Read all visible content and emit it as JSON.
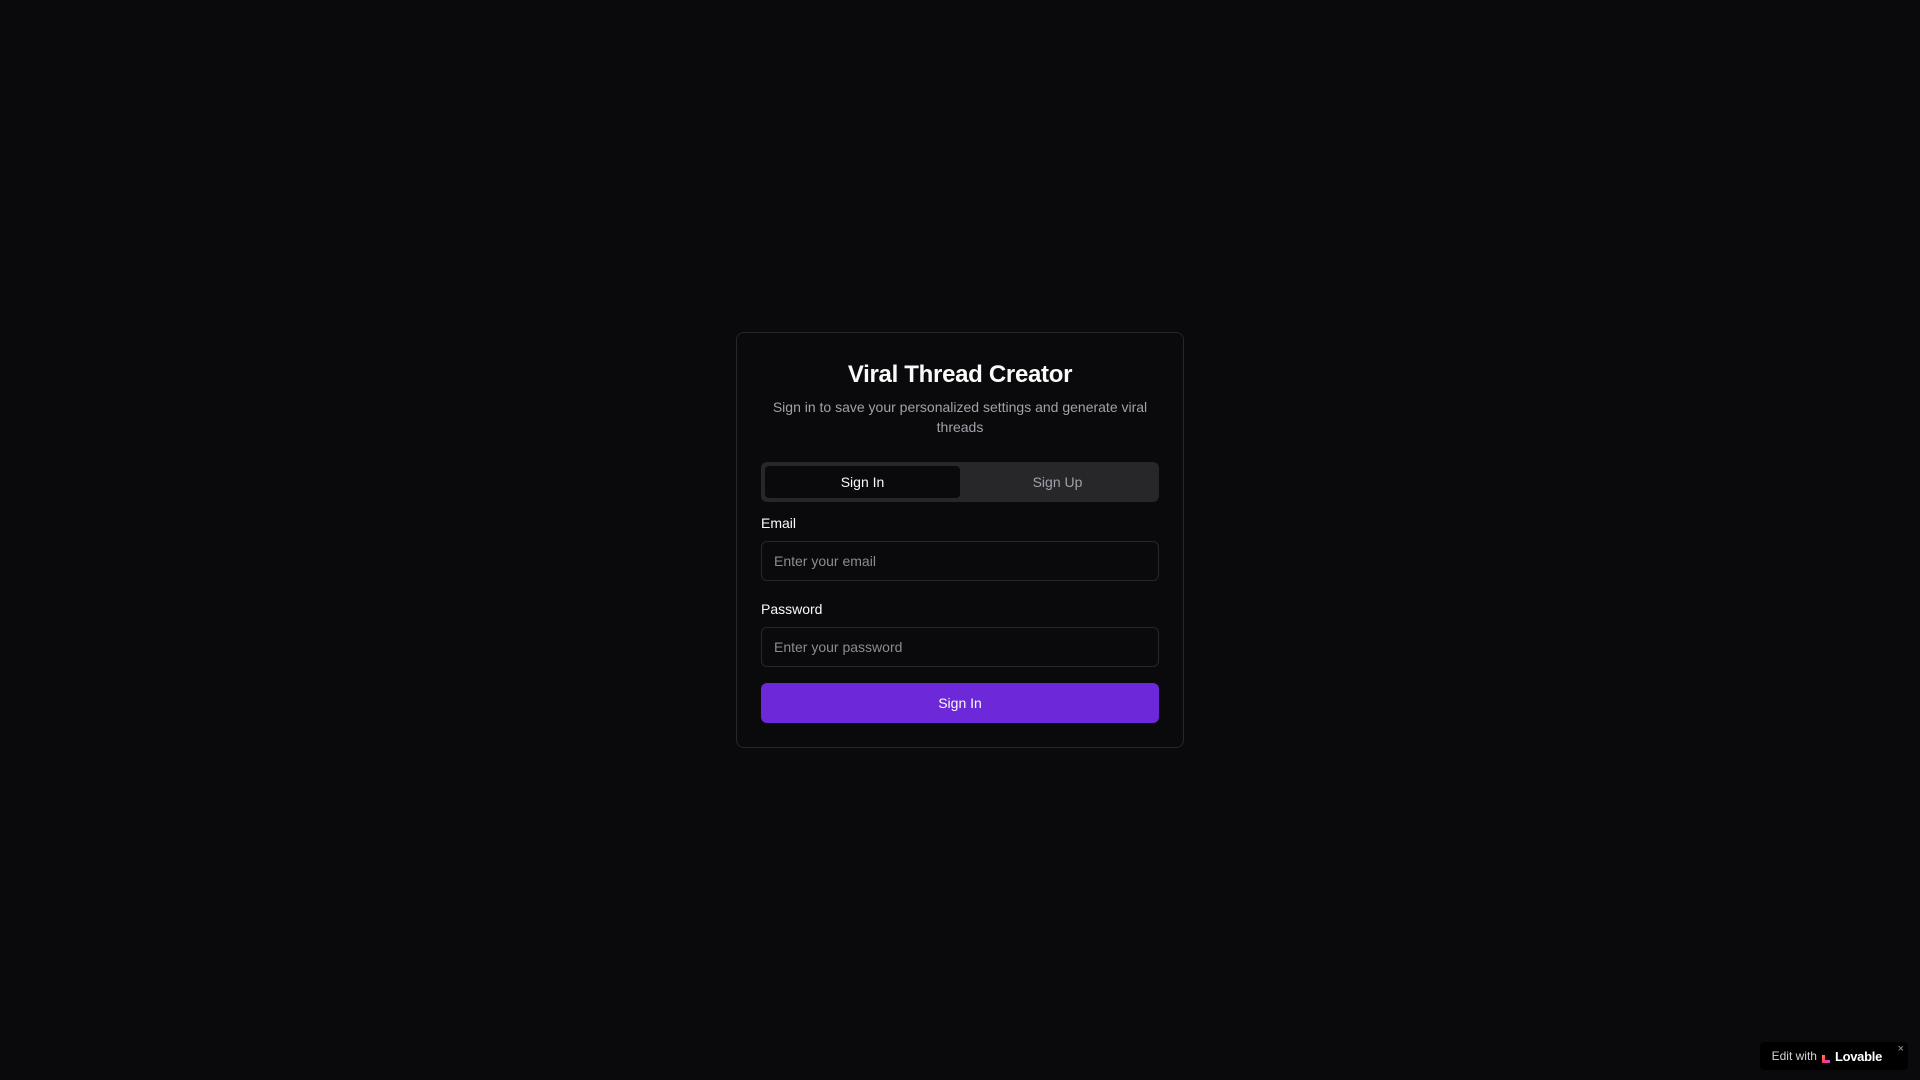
{
  "auth_card": {
    "title": "Viral Thread Creator",
    "subtitle": "Sign in to save your personalized settings and generate viral threads",
    "tabs": [
      {
        "label": "Sign In",
        "active": true
      },
      {
        "label": "Sign Up",
        "active": false
      }
    ],
    "email": {
      "label": "Email",
      "placeholder": "Enter your email",
      "value": ""
    },
    "password": {
      "label": "Password",
      "placeholder": "Enter your password",
      "value": ""
    },
    "submit_label": "Sign In"
  },
  "lovable_badge": {
    "prefix": "Edit with",
    "brand": "Lovable",
    "close": "×",
    "icon": "lovable-heart-icon"
  },
  "colors": {
    "background": "#0a0a0c",
    "accent": "#6d28d9",
    "border": "#27272a",
    "muted_text": "#a1a1aa"
  }
}
